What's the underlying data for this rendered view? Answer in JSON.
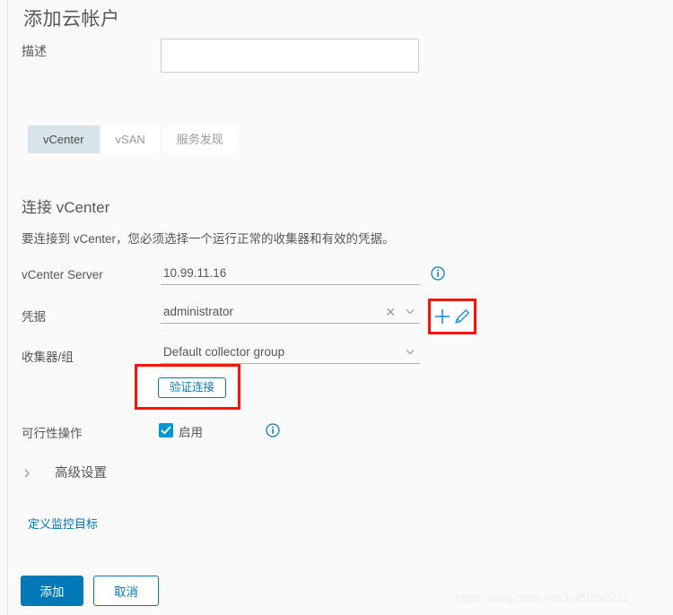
{
  "dialog": {
    "title": "添加云帐户"
  },
  "description_field": {
    "label": "描述",
    "value": "",
    "placeholder": ""
  },
  "tabs": [
    {
      "label": "vCenter",
      "active": true
    },
    {
      "label": "vSAN",
      "active": false
    },
    {
      "label": "服务发现",
      "active": false
    }
  ],
  "section": {
    "title": "连接 vCenter",
    "description": "要连接到 vCenter，您必须选择一个运行正常的收集器和有效的凭据。"
  },
  "form": {
    "vcenter_server": {
      "label": "vCenter Server",
      "value": "10.99.11.16",
      "info_icon": "info-circle-icon"
    },
    "credential": {
      "label": "凭据",
      "value": "administrator",
      "clear_icon": "close-x-icon",
      "dropdown_icon": "chevron-down-icon",
      "add_icon": "plus-icon",
      "edit_icon": "pencil-icon"
    },
    "collector": {
      "label": "收集器/组",
      "value": "Default collector group",
      "dropdown_icon": "chevron-down-icon"
    },
    "validate_button": {
      "label": "验证连接"
    },
    "actionable": {
      "label": "可行性操作",
      "checkbox_label": "启用",
      "checked": true,
      "info_icon": "info-circle-icon"
    }
  },
  "advanced": {
    "label": "高级设置",
    "expand_icon": "chevron-right-icon",
    "expanded": false
  },
  "links": {
    "define_targets": "定义监控目标"
  },
  "footer": {
    "submit_label": "添加",
    "cancel_label": "取消"
  },
  "watermark": {
    "text": "https://blog.csdn.net/zyj81092211"
  },
  "colors": {
    "accent": "#0079b8",
    "checkbox": "#0095d3",
    "highlight": "#fc1204",
    "active_tab_bg": "#d9e4ea",
    "link": "#0076b1",
    "background": "#fafafa"
  }
}
